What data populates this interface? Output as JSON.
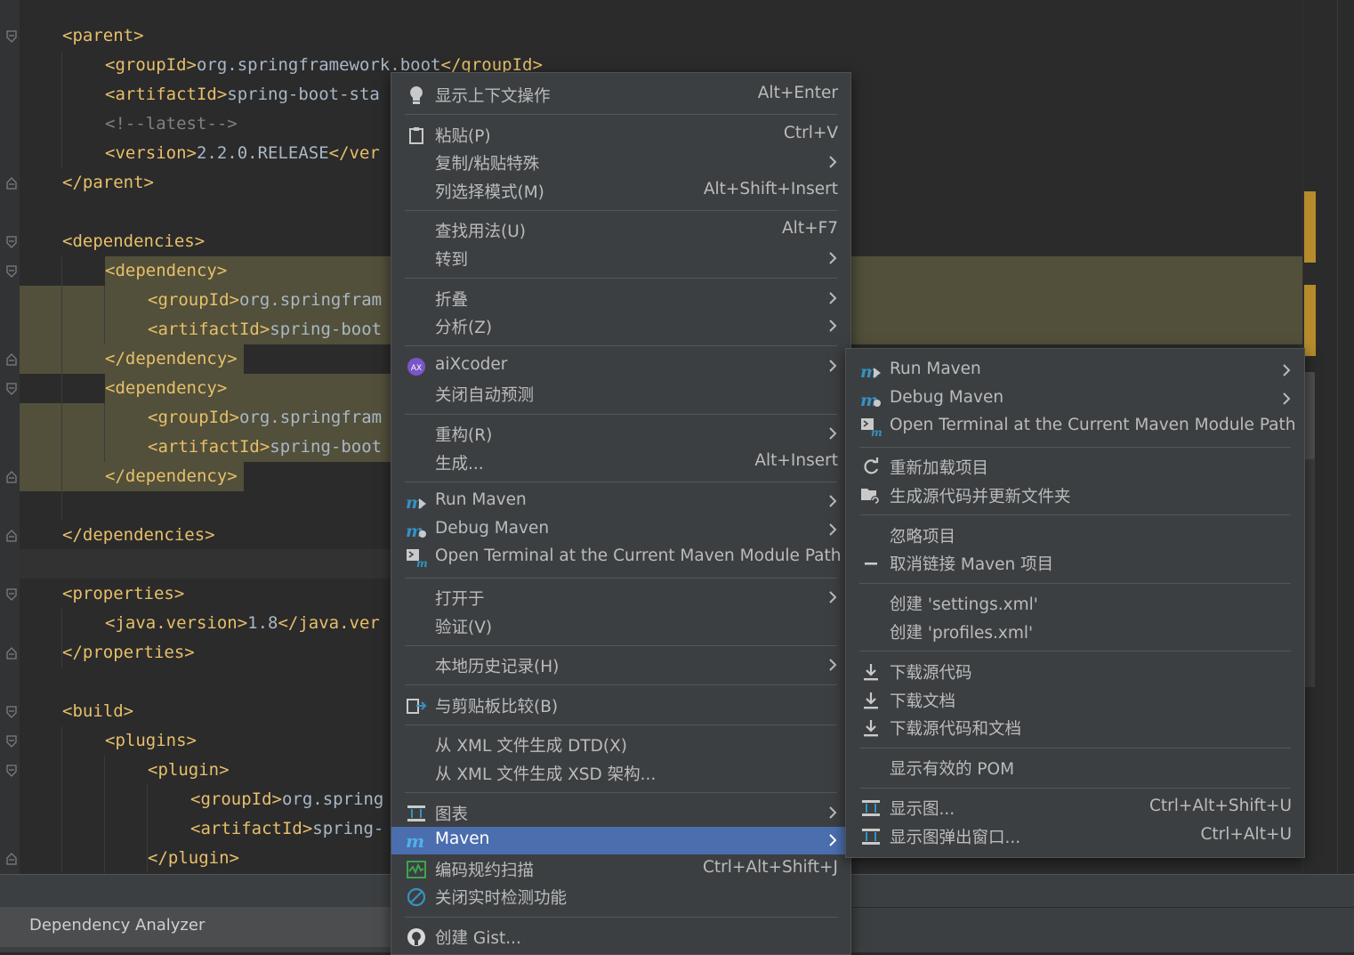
{
  "editor": {
    "lines": [
      {
        "t": "<parent>",
        "indent": 1
      },
      {
        "t": "<groupId>org.springframework.boot</groupId>",
        "indent": 2
      },
      {
        "t": "<artifactId>spring-boot-sta",
        "indent": 2
      },
      {
        "t": "<!--latest-->",
        "indent": 2,
        "comment": true
      },
      {
        "t": "<version>2.2.0.RELEASE</ver",
        "indent": 2
      },
      {
        "t": "</parent>",
        "indent": 1
      },
      {
        "t": "",
        "indent": 0
      },
      {
        "t": "<dependencies>",
        "indent": 1
      },
      {
        "t": "<dependency>",
        "indent": 2
      },
      {
        "t": "<groupId>org.springfram",
        "indent": 3
      },
      {
        "t": "<artifactId>spring-boot",
        "indent": 3
      },
      {
        "t": "</dependency>",
        "indent": 2
      },
      {
        "t": "<dependency>",
        "indent": 2
      },
      {
        "t": "<groupId>org.springfram",
        "indent": 3
      },
      {
        "t": "<artifactId>spring-boot",
        "indent": 3
      },
      {
        "t": "</dependency>",
        "indent": 2
      },
      {
        "t": "",
        "indent": 0
      },
      {
        "t": "</dependencies>",
        "indent": 1
      },
      {
        "t": "",
        "indent": 0
      },
      {
        "t": "<properties>",
        "indent": 1
      },
      {
        "t": "<java.version>1.8</java.ver",
        "indent": 2
      },
      {
        "t": "</properties>",
        "indent": 1
      },
      {
        "t": "",
        "indent": 0
      },
      {
        "t": "<build>",
        "indent": 1
      },
      {
        "t": "<plugins>",
        "indent": 2
      },
      {
        "t": "<plugin>",
        "indent": 3
      },
      {
        "t": "<groupId>org.spring",
        "indent": 4
      },
      {
        "t": "<artifactId>spring-",
        "indent": 4
      },
      {
        "t": "</plugin>",
        "indent": 3
      }
    ]
  },
  "bottom": {
    "dependency_analyzer_tab": "Dependency Analyzer"
  },
  "context_menu": {
    "items": [
      {
        "label": "显示上下文操作",
        "shortcut": "Alt+Enter",
        "icon": "lightbulb-icon"
      },
      {
        "sep": true
      },
      {
        "label": "粘贴(P)",
        "shortcut": "Ctrl+V",
        "icon": "paste-icon"
      },
      {
        "label": "复制/粘贴特殊",
        "submenu": true
      },
      {
        "label": "列选择模式(M)",
        "shortcut": "Alt+Shift+Insert"
      },
      {
        "sep": true
      },
      {
        "label": "查找用法(U)",
        "shortcut": "Alt+F7"
      },
      {
        "label": "转到",
        "submenu": true
      },
      {
        "sep": true
      },
      {
        "label": "折叠",
        "submenu": true
      },
      {
        "label": "分析(Z)",
        "submenu": true
      },
      {
        "sep": true
      },
      {
        "label": "aiXcoder",
        "submenu": true,
        "icon": "aixcoder-icon"
      },
      {
        "label": "关闭自动预测"
      },
      {
        "sep": true
      },
      {
        "label": "重构(R)",
        "submenu": true
      },
      {
        "label": "生成...",
        "shortcut": "Alt+Insert"
      },
      {
        "sep": true
      },
      {
        "label": "Run Maven",
        "submenu": true,
        "icon": "run-maven-icon"
      },
      {
        "label": "Debug Maven",
        "submenu": true,
        "icon": "debug-maven-icon"
      },
      {
        "label": "Open Terminal at the Current Maven Module Path",
        "icon": "maven-terminal-icon"
      },
      {
        "sep": true
      },
      {
        "label": "打开于",
        "submenu": true
      },
      {
        "label": "验证(V)"
      },
      {
        "sep": true
      },
      {
        "label": "本地历史记录(H)",
        "submenu": true
      },
      {
        "sep": true
      },
      {
        "label": "与剪贴板比较(B)",
        "icon": "compare-clipboard-icon"
      },
      {
        "sep": true
      },
      {
        "label": "从 XML 文件生成 DTD(X)"
      },
      {
        "label": "从 XML 文件生成 XSD 架构..."
      },
      {
        "sep": true
      },
      {
        "label": "图表",
        "submenu": true,
        "icon": "diagram-icon"
      },
      {
        "label": "Maven",
        "submenu": true,
        "icon": "maven-icon",
        "active": true
      },
      {
        "label": "编码规约扫描",
        "shortcut": "Ctrl+Alt+Shift+J",
        "icon": "code-scan-icon"
      },
      {
        "label": "关闭实时检测功能",
        "icon": "disable-icon"
      },
      {
        "sep": true
      },
      {
        "label": "创建 Gist...",
        "icon": "github-icon"
      }
    ]
  },
  "maven_submenu": {
    "items": [
      {
        "label": "Run Maven",
        "submenu": true,
        "icon": "run-maven-icon"
      },
      {
        "label": "Debug Maven",
        "submenu": true,
        "icon": "debug-maven-icon"
      },
      {
        "label": "Open Terminal at the Current Maven Module Path",
        "icon": "maven-terminal-icon"
      },
      {
        "sep": true
      },
      {
        "label": "重新加载项目",
        "icon": "reload-icon"
      },
      {
        "label": "生成源代码并更新文件夹",
        "icon": "generate-sources-icon"
      },
      {
        "sep": true
      },
      {
        "label": "忽略项目"
      },
      {
        "label": "取消链接 Maven 项目",
        "icon": "minus-icon"
      },
      {
        "sep": true
      },
      {
        "label": "创建 'settings.xml'"
      },
      {
        "label": "创建 'profiles.xml'"
      },
      {
        "sep": true
      },
      {
        "label": "下载源代码",
        "icon": "download-icon"
      },
      {
        "label": "下载文档",
        "icon": "download-icon"
      },
      {
        "label": "下载源代码和文档",
        "icon": "download-icon"
      },
      {
        "sep": true
      },
      {
        "label": "显示有效的 POM"
      },
      {
        "sep": true
      },
      {
        "label": "显示图...",
        "shortcut": "Ctrl+Alt+Shift+U",
        "icon": "diagram-icon"
      },
      {
        "label": "显示图弹出窗口...",
        "shortcut": "Ctrl+Alt+U",
        "icon": "diagram-icon"
      }
    ]
  }
}
